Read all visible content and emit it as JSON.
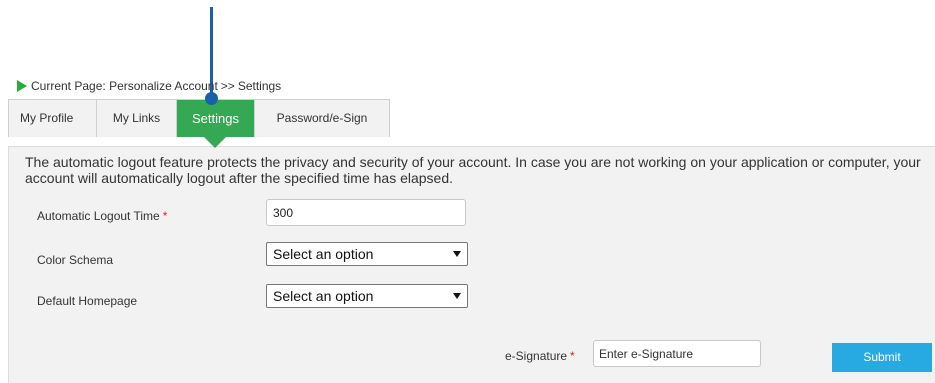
{
  "breadcrumb": {
    "prefix": "Current Page:",
    "section": "Personalize Account",
    "separator": ">>",
    "current": "Settings"
  },
  "tabs": [
    {
      "label": "My Profile",
      "active": false
    },
    {
      "label": "My Links",
      "active": false
    },
    {
      "label": "Settings",
      "active": true
    },
    {
      "label": "Password/e-Sign",
      "active": false
    }
  ],
  "settings": {
    "intro": "The automatic logout feature protects the privacy and security of your account. In case you are not working on your application or computer, your account will automatically logout after the specified time has elapsed.",
    "logout_label": "Automatic Logout Time",
    "logout_value": "300",
    "color_label": "Color Schema",
    "color_selected": "Select an option",
    "homepage_label": "Default Homepage",
    "homepage_selected": "Select an option",
    "required_marker": "*"
  },
  "signature": {
    "label": "e-Signature",
    "placeholder": "Enter e-Signature",
    "submit_label": "Submit"
  },
  "colors": {
    "active_tab": "#35a853",
    "breadcrumb_arrow": "#27ae3a",
    "submit": "#27aae1",
    "required": "#d9232e",
    "callout": "#1b5fa8"
  }
}
